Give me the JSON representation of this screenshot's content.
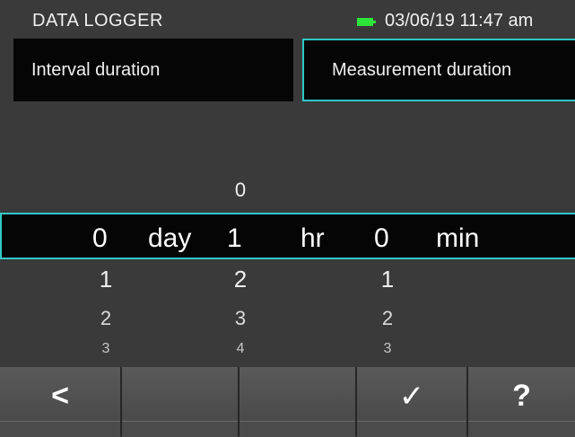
{
  "status": {
    "app_title": "DATA LOGGER",
    "battery_color": "#2ee53a",
    "battery_icon": "battery-icon",
    "datetime": "03/06/19 11:47 am"
  },
  "tabs": [
    {
      "label": "Interval duration",
      "selected": false
    },
    {
      "label": "Measurement duration",
      "selected": true
    }
  ],
  "accent_color": "#2fc8c6",
  "picker": {
    "hr_above": "0",
    "selected": {
      "day_value": "0",
      "day_unit": "day",
      "hr_value": "1",
      "hr_unit": "hr",
      "min_value": "0",
      "min_unit": "min"
    },
    "below": [
      {
        "day": "1",
        "hr": "2",
        "min": "1"
      },
      {
        "day": "2",
        "hr": "3",
        "min": "2"
      },
      {
        "day": "3",
        "hr": "4",
        "min": "3"
      }
    ]
  },
  "toolbar": {
    "back": "<",
    "confirm": "✓",
    "help": "?"
  }
}
